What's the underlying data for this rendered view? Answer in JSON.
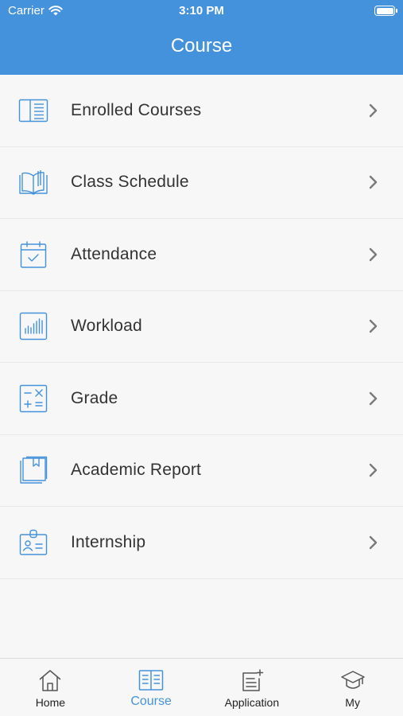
{
  "status_bar": {
    "carrier": "Carrier",
    "time": "3:10 PM"
  },
  "header": {
    "title": "Course"
  },
  "menu": {
    "items": [
      {
        "label": "Enrolled Courses",
        "icon": "enrolled-courses-icon"
      },
      {
        "label": "Class Schedule",
        "icon": "class-schedule-icon"
      },
      {
        "label": "Attendance",
        "icon": "attendance-icon"
      },
      {
        "label": "Workload",
        "icon": "workload-icon"
      },
      {
        "label": "Grade",
        "icon": "grade-icon"
      },
      {
        "label": "Academic Report",
        "icon": "academic-report-icon"
      },
      {
        "label": "Internship",
        "icon": "internship-icon"
      }
    ]
  },
  "tabbar": {
    "tabs": [
      {
        "label": "Home",
        "icon": "home-icon",
        "active": false
      },
      {
        "label": "Course",
        "icon": "course-book-icon",
        "active": true
      },
      {
        "label": "Application",
        "icon": "application-icon",
        "active": false
      },
      {
        "label": "My",
        "icon": "graduation-cap-icon",
        "active": false
      }
    ]
  },
  "colors": {
    "accent": "#4592dc",
    "text": "#333333",
    "background": "#f7f7f7",
    "chevron": "#7a7a7a"
  }
}
